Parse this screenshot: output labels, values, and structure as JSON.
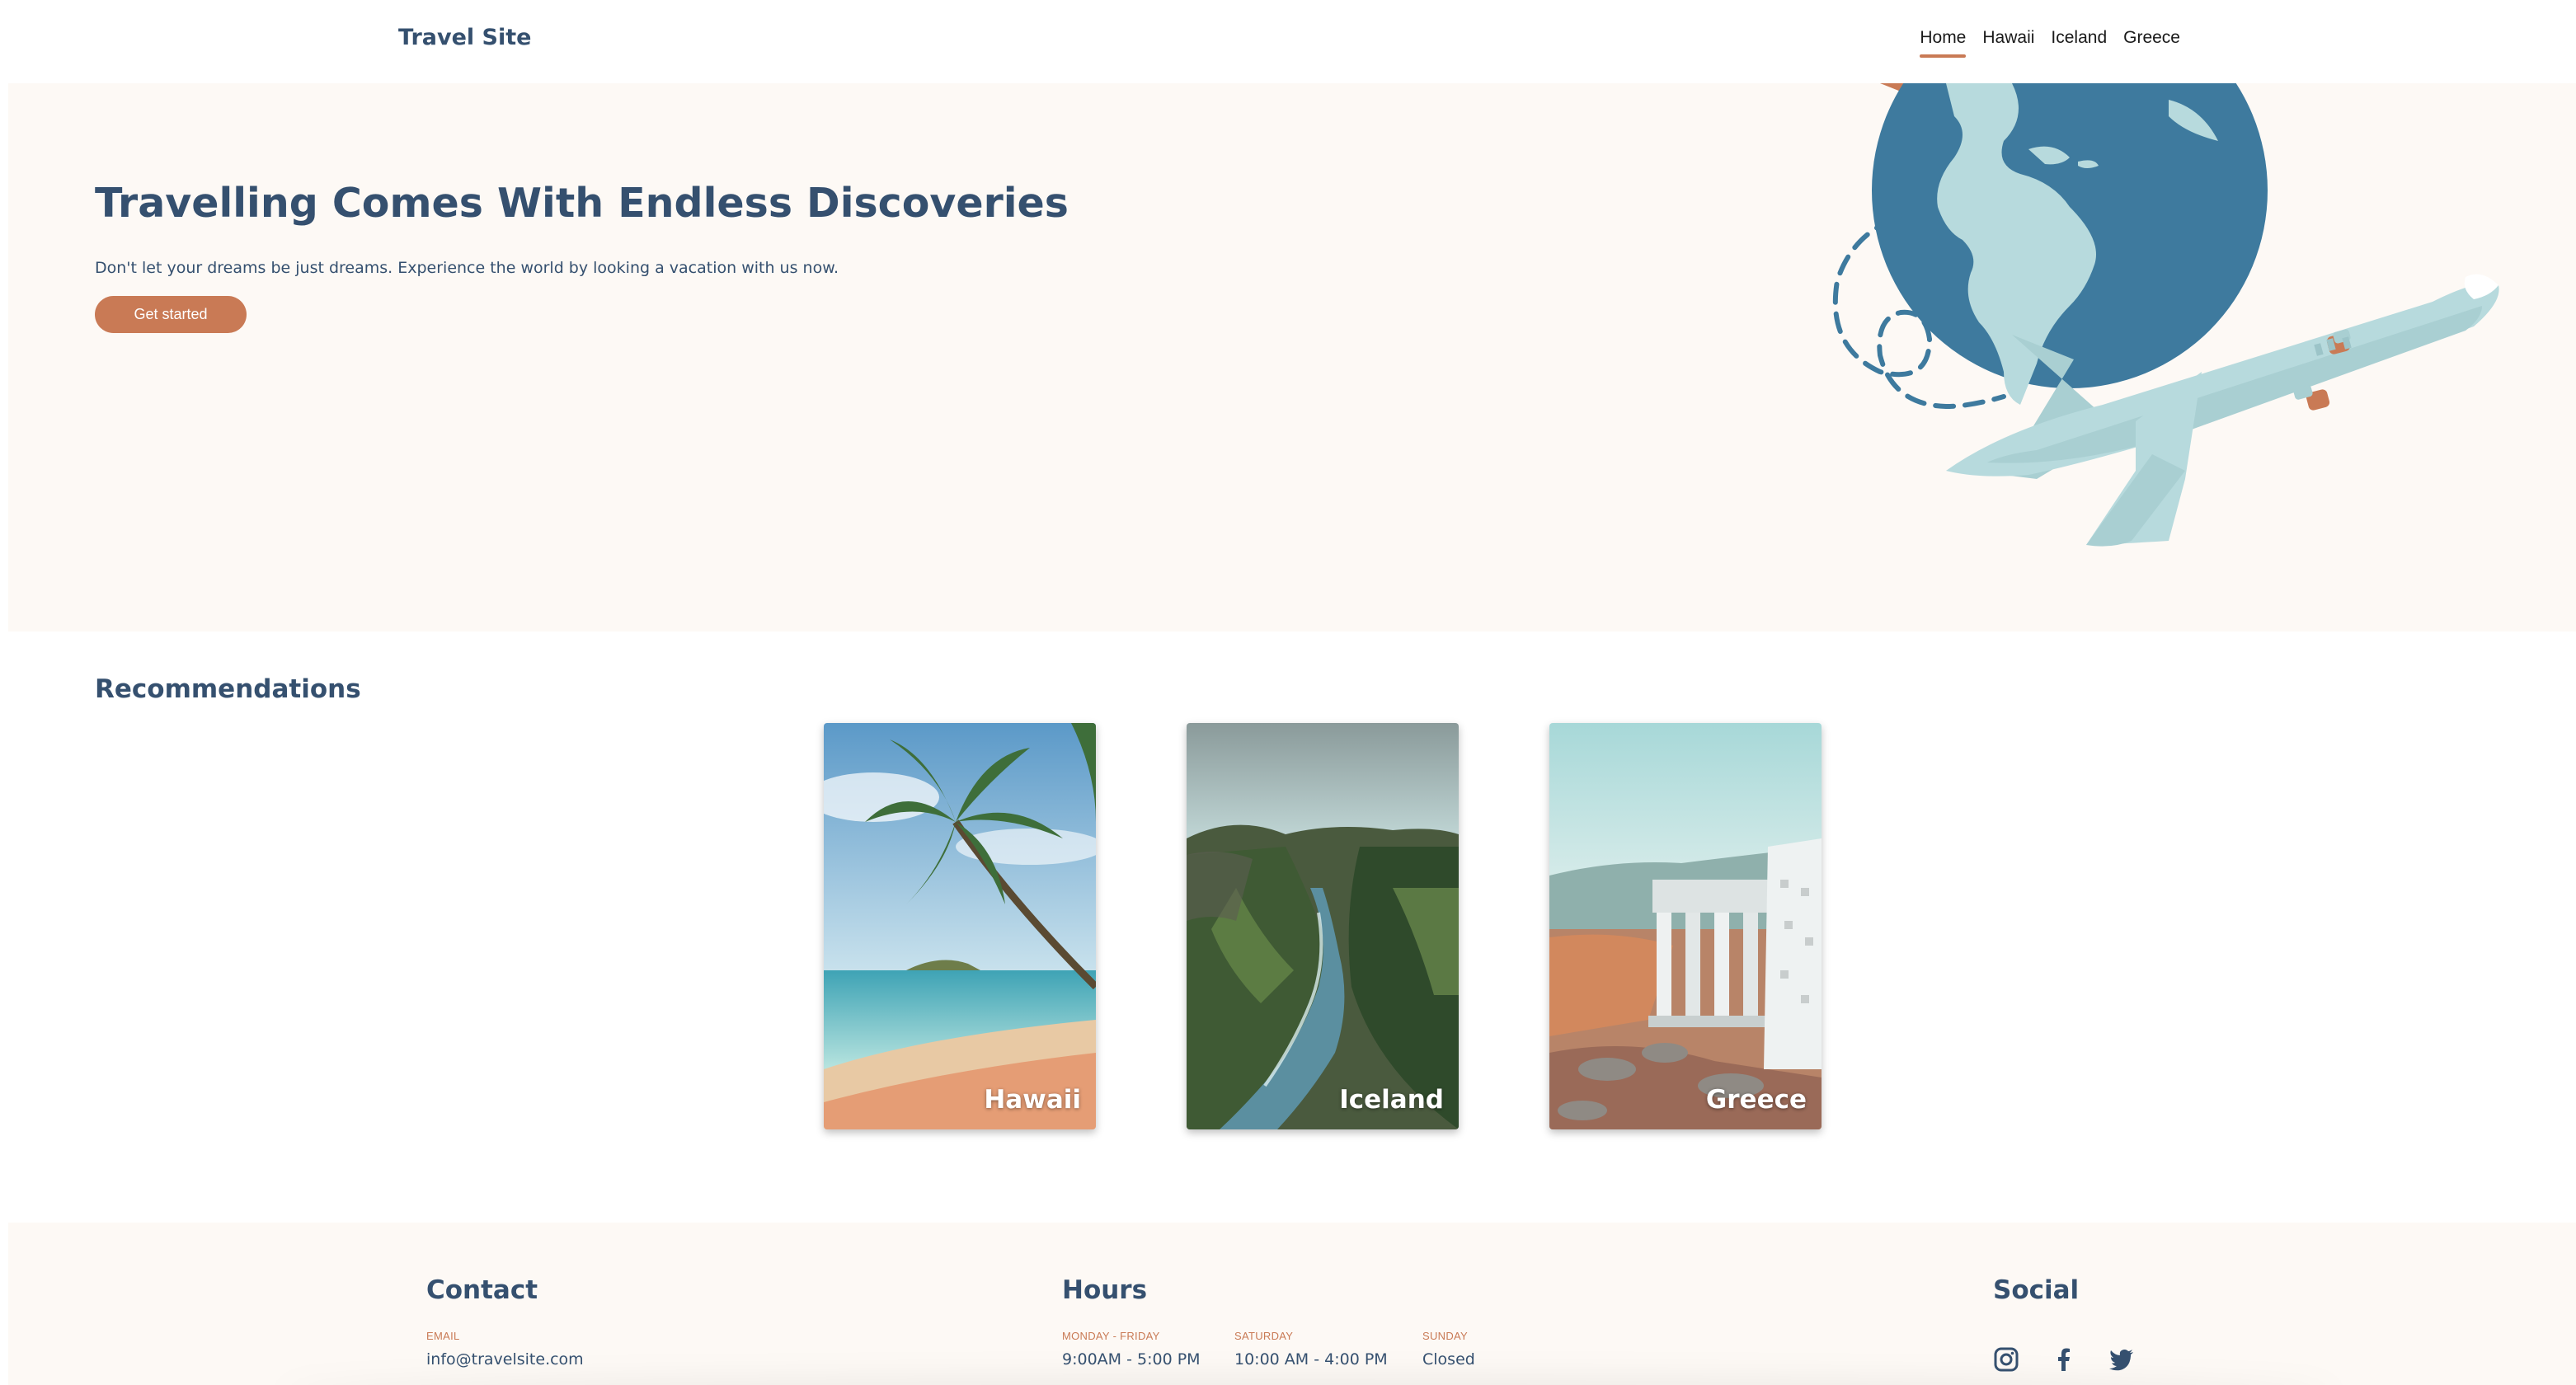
{
  "header": {
    "brand": "Travel Site",
    "nav": [
      "Home",
      "Hawaii",
      "Iceland",
      "Greece"
    ],
    "active": "Home"
  },
  "hero": {
    "title": "Travelling Comes With Endless Discoveries",
    "subtitle": "Don't let your dreams be just dreams. Experience the world by looking a vacation with us now.",
    "cta_label": "Get started",
    "art_icons": [
      "globe-illustration",
      "airplane-illustration",
      "dashed-flight-path"
    ]
  },
  "recommendations": {
    "title": "Recommendations",
    "cards": [
      {
        "label": "Hawaii",
        "image": "palm-beach-photo"
      },
      {
        "label": "Iceland",
        "image": "canyon-river-photo"
      },
      {
        "label": "Greece",
        "image": "temple-ruins-photo"
      }
    ]
  },
  "footer": {
    "contact": {
      "heading": "Contact",
      "email_label": "EMAIL",
      "email": "info@travelsite.com"
    },
    "hours": {
      "heading": "Hours",
      "items": [
        {
          "label": "MONDAY - FRIDAY",
          "value": "9:00AM - 5:00 PM"
        },
        {
          "label": "SATURDAY",
          "value": "10:00 AM - 4:00 PM"
        },
        {
          "label": "SUNDAY",
          "value": "Closed"
        }
      ]
    },
    "social": {
      "heading": "Social",
      "icons": [
        "instagram-icon",
        "facebook-icon",
        "twitter-icon"
      ]
    }
  },
  "colors": {
    "primary_text": "#35506f",
    "accent": "#c97a55",
    "hero_bg": "#fdf9f5",
    "globe_blue": "#3e7a9e",
    "light_blue": "#b7dadd"
  }
}
